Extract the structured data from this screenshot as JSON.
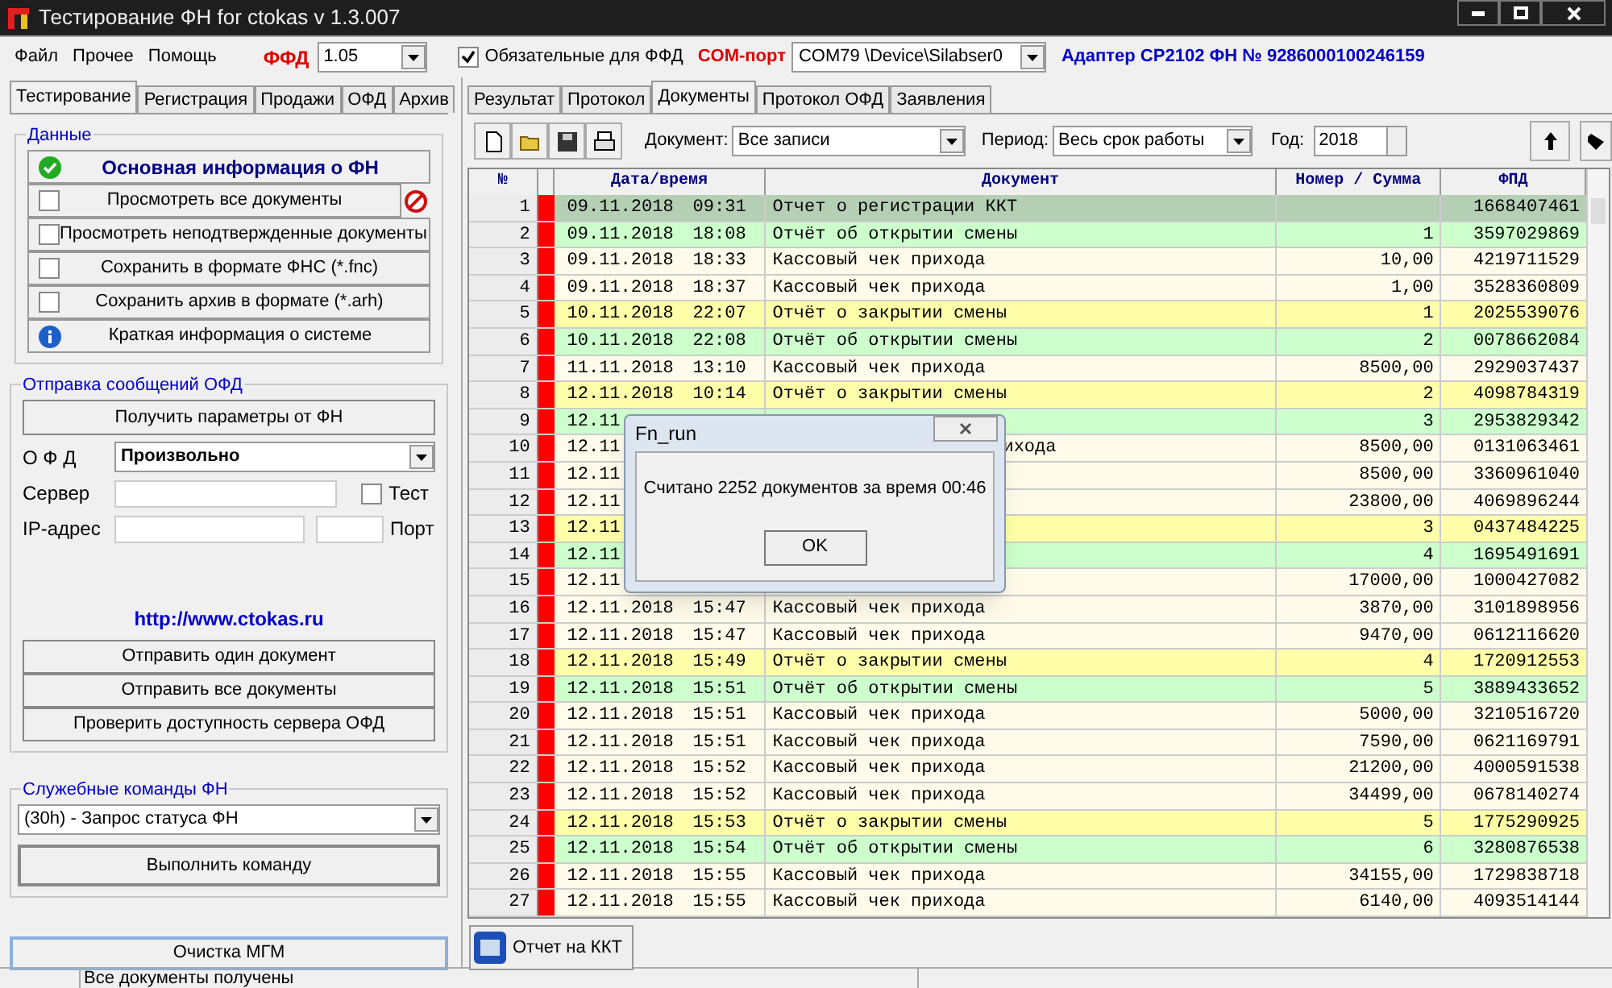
{
  "window": {
    "title": "Тестирование ФН for ctokas  v 1.3.007"
  },
  "menu": [
    "Файл",
    "Прочее",
    "Помощь"
  ],
  "ffd": {
    "label": "ФФД",
    "value": "1.05"
  },
  "mandatory": {
    "label": "Обязательные для ФФД",
    "checked": true
  },
  "com_port": {
    "label": "COM-порт",
    "value": "COM79 \\Device\\Silabser0"
  },
  "adapter": "Адаптер CP2102 ФН № 9286000100246159",
  "left_tabs": [
    {
      "label": "Тестирование",
      "selected": true
    },
    {
      "label": "Регистрация",
      "selected": false
    },
    {
      "label": "Продажи",
      "selected": false
    },
    {
      "label": "ОФД",
      "selected": false
    },
    {
      "label": "Архив",
      "selected": false
    }
  ],
  "data_group": {
    "title": "Данные",
    "items": [
      {
        "kind": "status",
        "label": "Основная информация о ФН"
      },
      {
        "kind": "checkbox",
        "label": "Просмотреть все документы",
        "checked": false
      },
      {
        "kind": "checkbox",
        "label": "Просмотреть неподтвержденные документы",
        "checked": false
      },
      {
        "kind": "checkbox",
        "label": "Сохранить в формате ФНС  (*.fnc)",
        "checked": false
      },
      {
        "kind": "checkbox",
        "label": "Сохранить архив в формате (*.arh)",
        "checked": false
      },
      {
        "kind": "info",
        "label": "Краткая информация о системе"
      }
    ]
  },
  "ofd_group": {
    "title": "Отправка сообщений ОФД",
    "get_params": "Получить параметры от ФН",
    "ofd_label": "О Ф Д",
    "ofd_value": "Произвольно",
    "server_label": "Сервер",
    "test": {
      "label": "Тест",
      "checked": false
    },
    "ip_label": "IP-адрес",
    "port_label": "Порт",
    "link": "http://www.ctokas.ru",
    "buttons": [
      "Отправить один документ",
      "Отправить все документы",
      "Проверить доступность сервера ОФД"
    ]
  },
  "service_group": {
    "title": "Служебные команды ФН",
    "command": "(30h) - Запрос статуса ФН",
    "run": "Выполнить команду"
  },
  "clear_button": "Очистка МГМ",
  "right_tabs": [
    {
      "label": "Результат",
      "selected": false
    },
    {
      "label": "Протокол",
      "selected": false
    },
    {
      "label": "Документы",
      "selected": true
    },
    {
      "label": "Протокол ОФД",
      "selected": false
    },
    {
      "label": "Заявления",
      "selected": false
    }
  ],
  "filters": {
    "document_label": "Документ:",
    "document_value": "Все записи",
    "period_label": "Период:",
    "period_value": "Весь срок работы",
    "year_label": "Год:",
    "year_value": "2018"
  },
  "table": {
    "columns": [
      "№",
      "Дата/время",
      "Документ",
      "Номер / Сумма",
      "ФПД"
    ],
    "rows": [
      {
        "n": "1",
        "date": "09.11.2018",
        "time": "09:31",
        "document": "Отчет о регистрации ККТ",
        "sum": "",
        "fpd": "1668407461",
        "kind": "registration",
        "selected": true,
        "color": "#ff0000"
      },
      {
        "n": "2",
        "date": "09.11.2018",
        "time": "18:08",
        "document": "Отчёт об открытии смены",
        "sum": "1",
        "fpd": "3597029869",
        "kind": "open",
        "selected": false,
        "color": "#ff0000"
      },
      {
        "n": "3",
        "date": "09.11.2018",
        "time": "18:33",
        "document": "Кассовый чек прихода",
        "sum": "10,00",
        "fpd": "4219711529",
        "kind": "receipt",
        "selected": false,
        "color": "#ff0000"
      },
      {
        "n": "4",
        "date": "09.11.2018",
        "time": "18:37",
        "document": "Кассовый чек прихода",
        "sum": "1,00",
        "fpd": "3528360809",
        "kind": "receipt",
        "selected": false,
        "color": "#ff0000"
      },
      {
        "n": "5",
        "date": "10.11.2018",
        "time": "22:07",
        "document": "Отчёт о закрытии смены",
        "sum": "1",
        "fpd": "2025539076",
        "kind": "close",
        "selected": false,
        "color": "#ff0000"
      },
      {
        "n": "6",
        "date": "10.11.2018",
        "time": "22:08",
        "document": "Отчёт об открытии смены",
        "sum": "2",
        "fpd": "0078662084",
        "kind": "open",
        "selected": false,
        "color": "#ff0000"
      },
      {
        "n": "7",
        "date": "11.11.2018",
        "time": "13:10",
        "document": "Кассовый чек прихода",
        "sum": "8500,00",
        "fpd": "2929037437",
        "kind": "receipt",
        "selected": false,
        "color": "#ff0000"
      },
      {
        "n": "8",
        "date": "12.11.2018",
        "time": "10:14",
        "document": "Отчёт о закрытии смены",
        "sum": "2",
        "fpd": "4098784319",
        "kind": "close",
        "selected": false,
        "color": "#ff0000"
      },
      {
        "n": "9",
        "date": "12.11",
        "sum": "3",
        "fpd": "2953829342",
        "kind": "open",
        "selected": false,
        "color": "#ff0000"
      },
      {
        "n": "10",
        "date": "12.11",
        "document_tail": "ихода",
        "sum": "8500,00",
        "fpd": "0131063461",
        "kind": "receipt",
        "selected": false,
        "color": "#ff0000"
      },
      {
        "n": "11",
        "date": "12.11",
        "sum": "8500,00",
        "fpd": "3360961040",
        "kind": "receipt",
        "selected": false,
        "color": "#ff0000"
      },
      {
        "n": "12",
        "date": "12.11",
        "sum": "23800,00",
        "fpd": "4069896244",
        "kind": "receipt",
        "selected": false,
        "color": "#ff0000"
      },
      {
        "n": "13",
        "date": "12.11",
        "sum": "3",
        "fpd": "0437484225",
        "kind": "close",
        "selected": false,
        "color": "#ff0000"
      },
      {
        "n": "14",
        "date": "12.11",
        "sum": "4",
        "fpd": "1695491691",
        "kind": "open",
        "selected": false,
        "color": "#ff0000"
      },
      {
        "n": "15",
        "date": "12.11",
        "sum": "17000,00",
        "fpd": "1000427082",
        "kind": "receipt",
        "selected": false,
        "color": "#ff0000"
      },
      {
        "n": "16",
        "date": "12.11.2018",
        "time": "15:47",
        "document": "Кассовый чек прихода",
        "sum": "3870,00",
        "fpd": "3101898956",
        "kind": "receipt",
        "selected": false,
        "color": "#ff0000"
      },
      {
        "n": "17",
        "date": "12.11.2018",
        "time": "15:47",
        "document": "Кассовый чек прихода",
        "sum": "9470,00",
        "fpd": "0612116620",
        "kind": "receipt",
        "selected": false,
        "color": "#ff0000"
      },
      {
        "n": "18",
        "date": "12.11.2018",
        "time": "15:49",
        "document": "Отчёт о закрытии смены",
        "sum": "4",
        "fpd": "1720912553",
        "kind": "close",
        "selected": false,
        "color": "#ff0000"
      },
      {
        "n": "19",
        "date": "12.11.2018",
        "time": "15:51",
        "document": "Отчёт об открытии смены",
        "sum": "5",
        "fpd": "3889433652",
        "kind": "open",
        "selected": false,
        "color": "#ff0000"
      },
      {
        "n": "20",
        "date": "12.11.2018",
        "time": "15:51",
        "document": "Кассовый чек прихода",
        "sum": "5000,00",
        "fpd": "3210516720",
        "kind": "receipt",
        "selected": false,
        "color": "#ff0000"
      },
      {
        "n": "21",
        "date": "12.11.2018",
        "time": "15:51",
        "document": "Кассовый чек прихода",
        "sum": "7590,00",
        "fpd": "0621169791",
        "kind": "receipt",
        "selected": false,
        "color": "#ff0000"
      },
      {
        "n": "22",
        "date": "12.11.2018",
        "time": "15:52",
        "document": "Кассовый чек прихода",
        "sum": "21200,00",
        "fpd": "4000591538",
        "kind": "receipt",
        "selected": false,
        "color": "#ff0000"
      },
      {
        "n": "23",
        "date": "12.11.2018",
        "time": "15:52",
        "document": "Кассовый чек прихода",
        "sum": "34499,00",
        "fpd": "0678140274",
        "kind": "receipt",
        "selected": false,
        "color": "#ff0000"
      },
      {
        "n": "24",
        "date": "12.11.2018",
        "time": "15:53",
        "document": "Отчёт о закрытии смены",
        "sum": "5",
        "fpd": "1775290925",
        "kind": "close",
        "selected": false,
        "color": "#ff0000"
      },
      {
        "n": "25",
        "date": "12.11.2018",
        "time": "15:54",
        "document": "Отчёт об открытии смены",
        "sum": "6",
        "fpd": "3280876538",
        "kind": "open",
        "selected": false,
        "color": "#ff0000"
      },
      {
        "n": "26",
        "date": "12.11.2018",
        "time": "15:55",
        "document": "Кассовый чек прихода",
        "sum": "34155,00",
        "fpd": "1729838718",
        "kind": "receipt",
        "selected": false,
        "color": "#ff0000"
      },
      {
        "n": "27",
        "date": "12.11.2018",
        "time": "15:55",
        "document": "Кассовый чек прихода",
        "sum": "6140,00",
        "fpd": "4093514144",
        "kind": "receipt",
        "selected": false,
        "color": "#ff0000"
      }
    ]
  },
  "report_button": "Отчет на ККТ",
  "dialog": {
    "title": "Fn_run",
    "message": "Считано 2252 документов за время 00:46",
    "ok": "OK"
  },
  "status_bar": "Все документы получены"
}
